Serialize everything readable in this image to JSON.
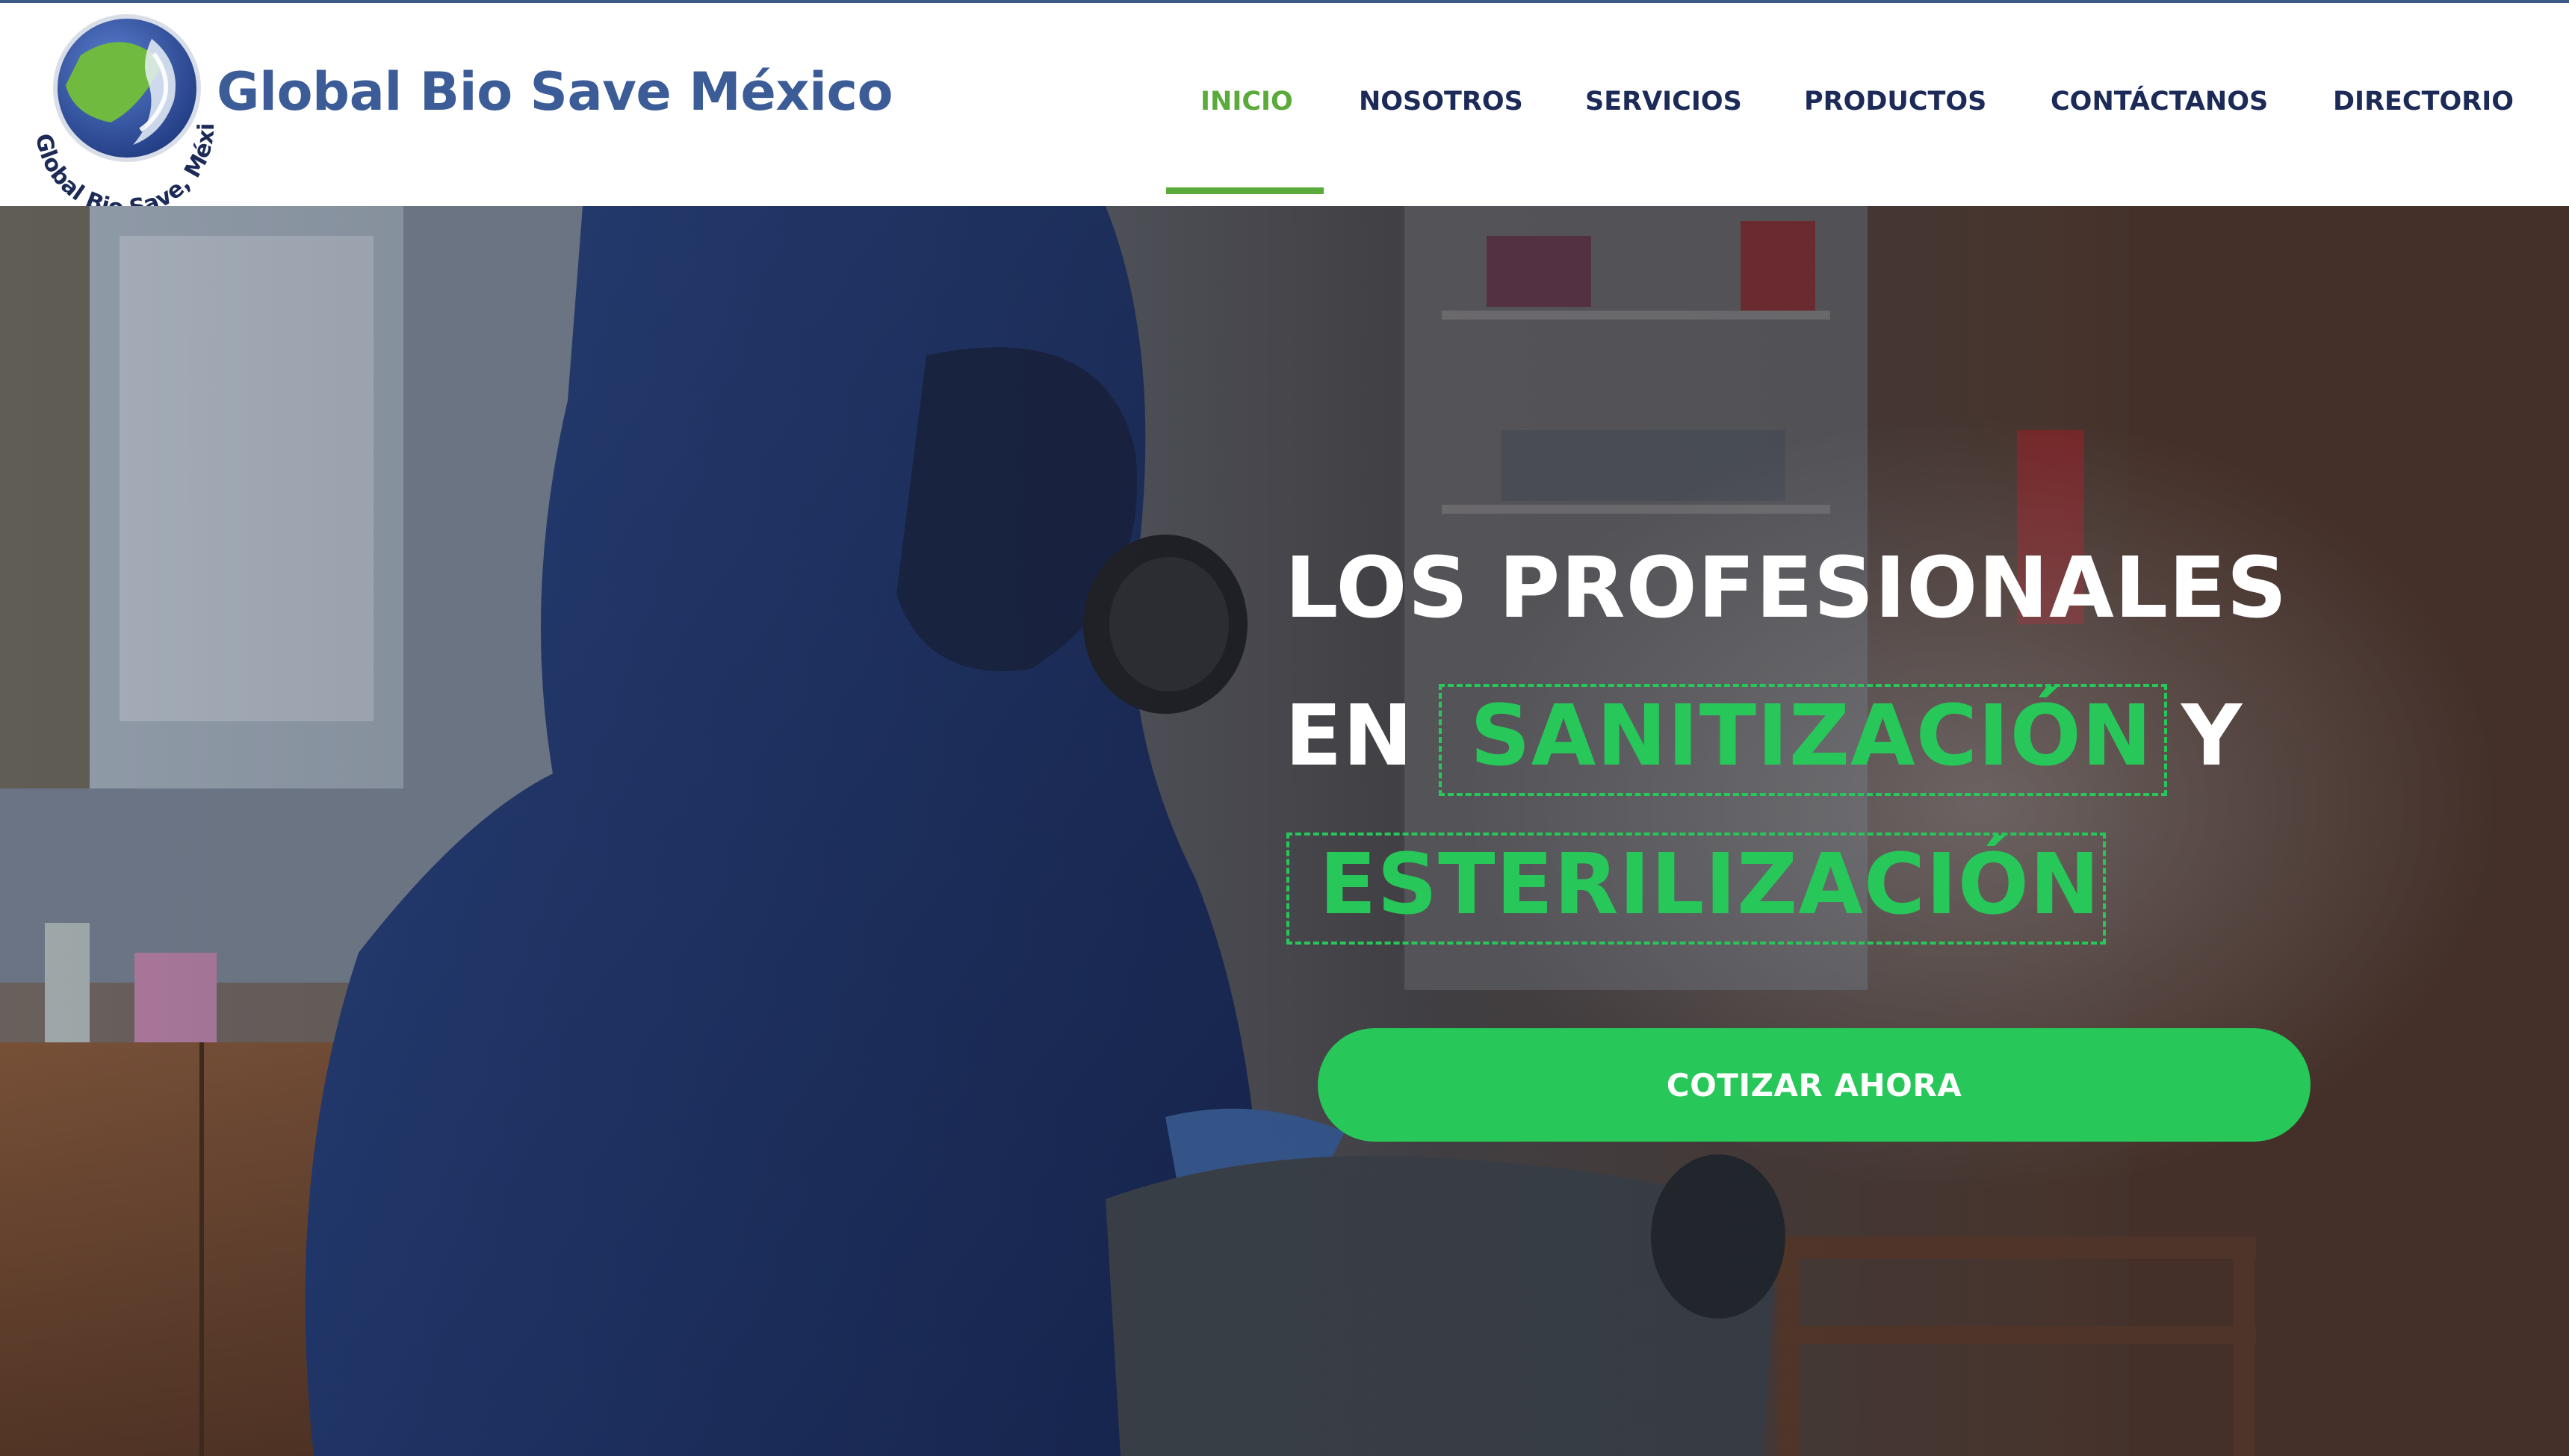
{
  "header": {
    "brand_name": "Global Bio Save México",
    "logo_text": "Global Bio Save, México",
    "nav": [
      {
        "label": "INICIO",
        "active": true
      },
      {
        "label": "NOSOTROS",
        "active": false
      },
      {
        "label": "SERVICIOS",
        "active": false
      },
      {
        "label": "PRODUCTOS",
        "active": false
      },
      {
        "label": "CONTÁCTANOS",
        "active": false
      },
      {
        "label": "DIRECTORIO",
        "active": false
      }
    ]
  },
  "hero": {
    "line1": "LOS PROFESIONALES",
    "line2_prefix": "EN",
    "line2_highlight": "SANITIZACIÓN",
    "line2_suffix": "Y",
    "line3_highlight": "ESTERILIZACIÓN",
    "cta_label": "COTIZAR AHORA"
  },
  "colors": {
    "brand_blue": "#3b5c97",
    "nav_text": "#1c2a57",
    "accent_green": "#27c759",
    "active_green": "#5aaa3c"
  }
}
